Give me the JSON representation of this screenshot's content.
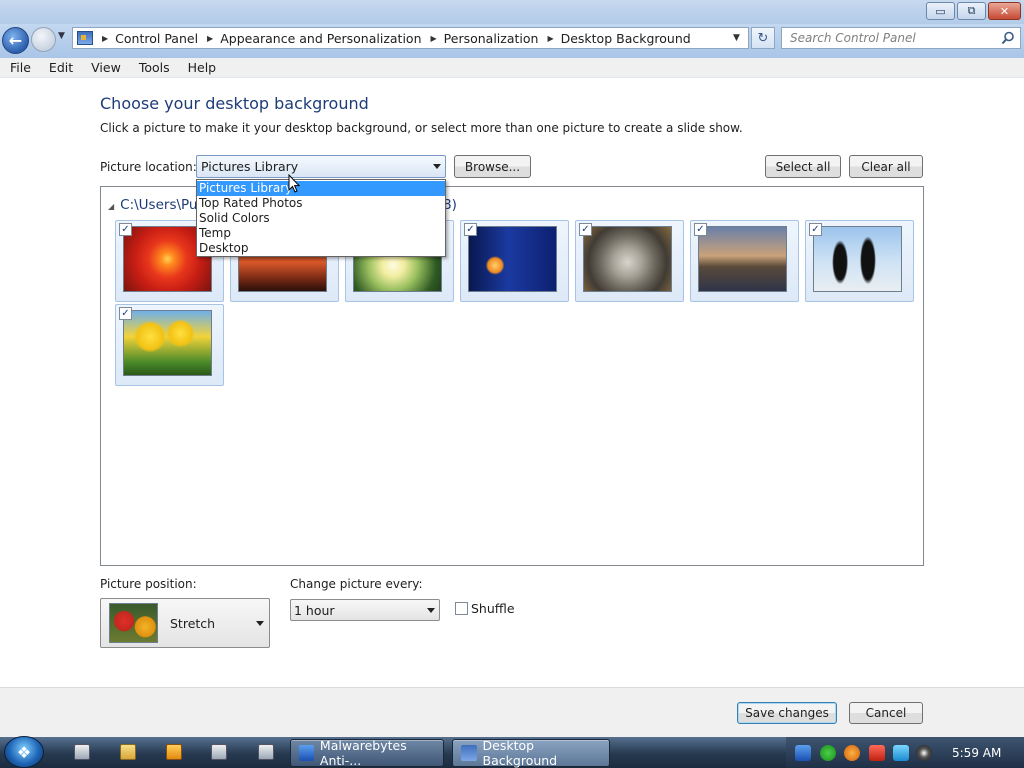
{
  "window": {
    "minimize_glyph": "▭",
    "maximize_glyph": "⧉",
    "close_glyph": "✕"
  },
  "address_bar": {
    "breadcrumbs": [
      "Control Panel",
      "Appearance and Personalization",
      "Personalization",
      "Desktop Background"
    ],
    "search_placeholder": "Search Control Panel"
  },
  "menu": [
    "File",
    "Edit",
    "View",
    "Tools",
    "Help"
  ],
  "main": {
    "title": "Choose your desktop background",
    "description": "Click a picture to make it your desktop background, or select more than one picture to create a slide show.",
    "location_label": "Picture location:",
    "location_value": "Pictures Library",
    "location_options": [
      "Pictures Library",
      "Top Rated Photos",
      "Solid Colors",
      "Temp",
      "Desktop"
    ],
    "location_selected_index": 0,
    "browse_label": "Browse...",
    "select_all_label": "Select all",
    "clear_all_label": "Clear all",
    "folder_path_visible": "C:\\Users\\Pu",
    "folder_count_visible": "8)",
    "pictures": [
      {
        "name": "Chrysanthemum",
        "checked": true
      },
      {
        "name": "Desert",
        "checked": true
      },
      {
        "name": "Hydrangeas",
        "checked": true
      },
      {
        "name": "Jellyfish",
        "checked": true
      },
      {
        "name": "Koala",
        "checked": true
      },
      {
        "name": "Lighthouse",
        "checked": true
      },
      {
        "name": "Penguins",
        "checked": true
      },
      {
        "name": "Tulips",
        "checked": true
      }
    ],
    "position_label": "Picture position:",
    "position_value": "Stretch",
    "change_label": "Change picture every:",
    "change_value": "1 hour",
    "shuffle_label": "Shuffle",
    "shuffle_checked": false
  },
  "footer": {
    "save_label": "Save changes",
    "cancel_label": "Cancel"
  },
  "taskbar": {
    "tasks": [
      "Malwarebytes Anti-...",
      "Desktop Background"
    ],
    "active_task_index": 1,
    "clock": "5:59 AM"
  }
}
